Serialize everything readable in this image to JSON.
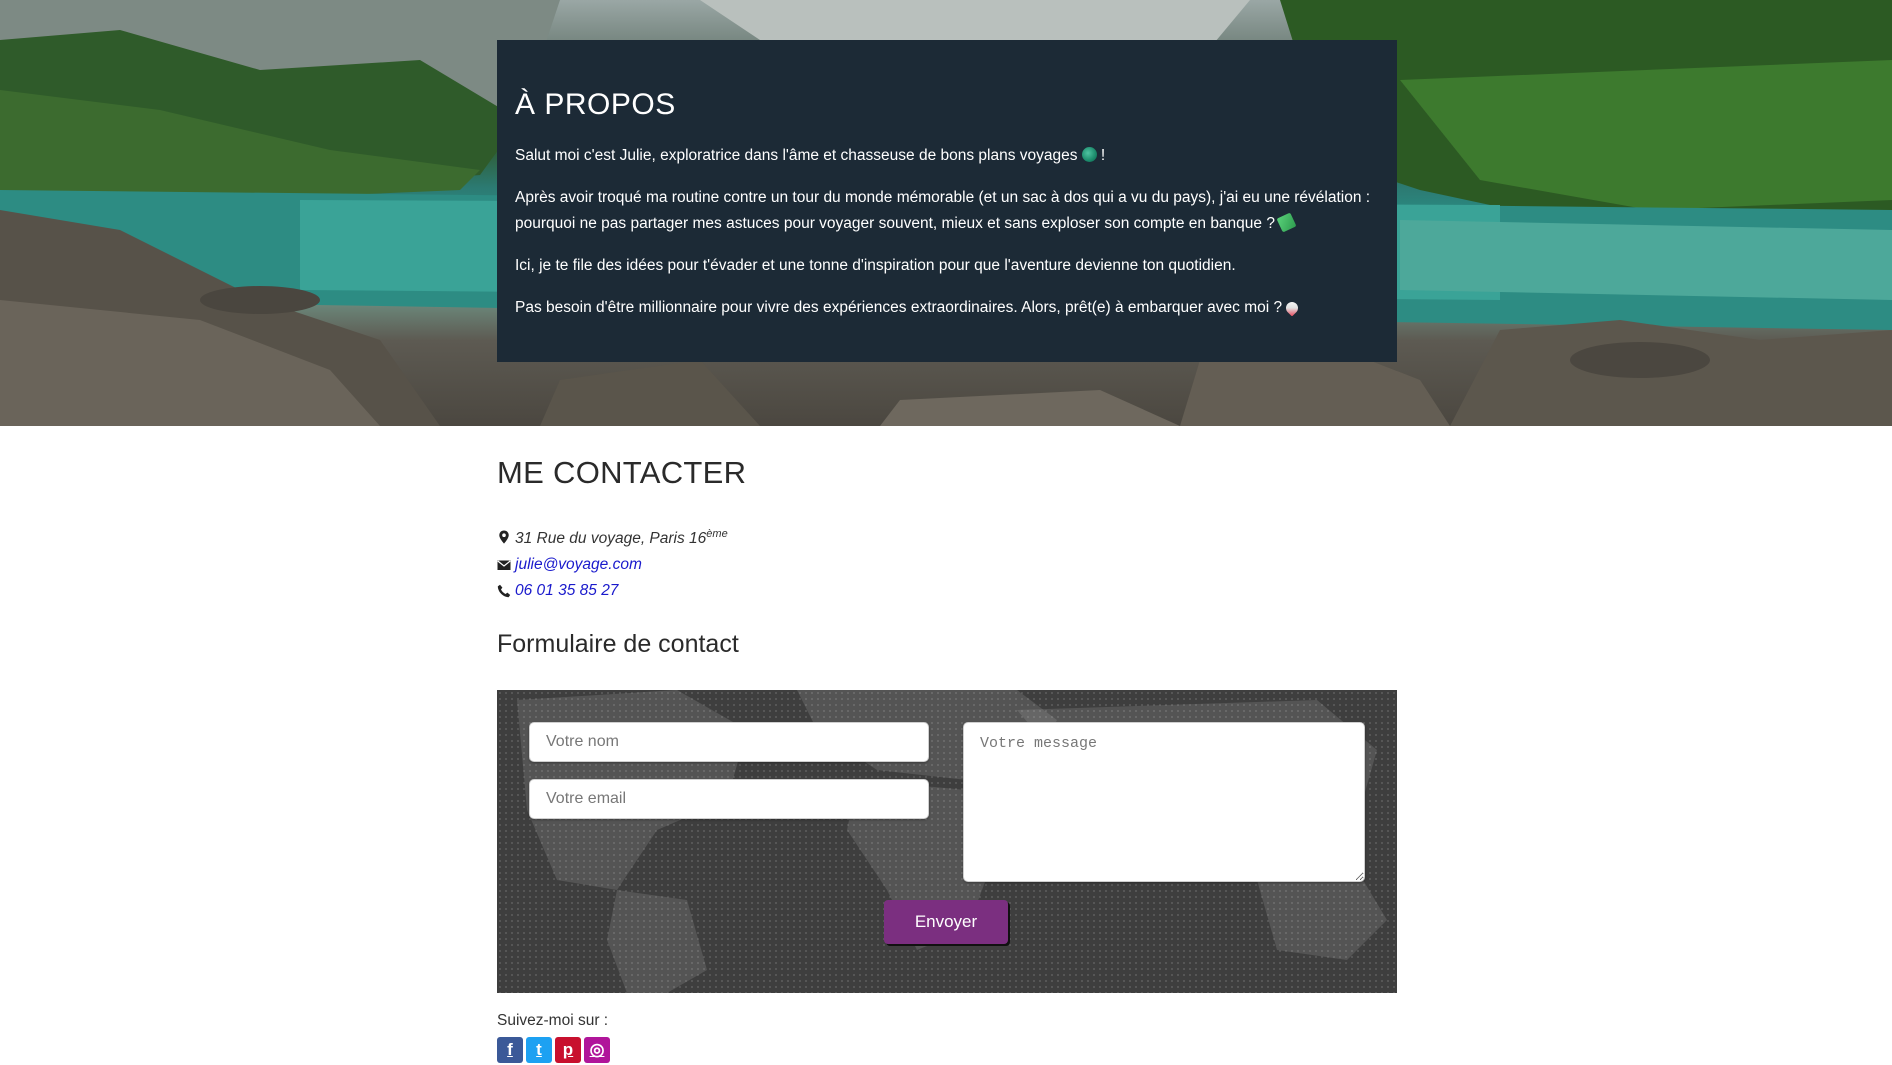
{
  "about": {
    "title": "À PROPOS",
    "p1": "Salut moi c'est Julie, exploratrice dans l'âme et chasseuse de bons plans voyages",
    "p1_end": " !",
    "p2": "Après avoir troqué ma routine contre un tour du monde mémorable (et un sac à dos qui a vu du pays), j'ai eu une révélation : pourquoi ne pas partager mes astuces pour voyager souvent, mieux et sans exploser son compte en banque ?",
    "p3": "Ici, je te file des idées pour t'évader et une tonne d'inspiration pour que l'aventure devienne ton quotidien.",
    "p4": "Pas besoin d'être millionnaire pour vivre des expériences extraordinaires. Alors, prêt(e) à embarquer avec moi ?",
    "emoji_icons": [
      "globe-emoji",
      "money-emoji",
      "rocket-emoji"
    ]
  },
  "contact": {
    "title": "ME CONTACTER",
    "address": "31 Rue du voyage, Paris 16",
    "address_sup": "ème",
    "email": "julie@voyage.com",
    "phone": "06 01 35 85 27",
    "icons": [
      "map-marker-icon",
      "envelope-icon",
      "phone-icon"
    ],
    "link_color": "#1a1acc"
  },
  "form": {
    "title": "Formulaire de contact",
    "name_placeholder": "Votre nom",
    "email_placeholder": "Votre email",
    "message_placeholder": "Votre message",
    "submit_label": "Envoyer",
    "button_color": "#7b2f80",
    "background_color": "#3e3e3e"
  },
  "social": {
    "label": "Suivez-moi sur :",
    "icons": [
      {
        "name": "facebook-icon",
        "glyph": "f",
        "color": "#3b5998"
      },
      {
        "name": "twitter-icon",
        "glyph": "t",
        "color": "#1da1f2"
      },
      {
        "name": "pinterest-icon",
        "glyph": "p",
        "color": "#c8102e"
      },
      {
        "name": "instagram-icon",
        "glyph": "◎",
        "color": "#b0159a"
      }
    ]
  },
  "colors": {
    "about_card_bg": "#1c2a36"
  }
}
